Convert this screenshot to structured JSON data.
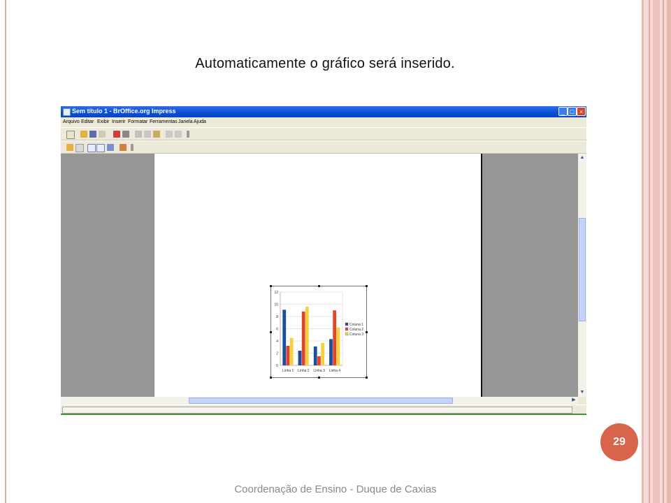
{
  "slide": {
    "title": "Automaticamente o gráfico será inserido.",
    "page_number": "29",
    "footer": "Coordenação de Ensino - Duque de Caxias"
  },
  "window": {
    "title": "Sem título 1 - BrOffice.org Impress",
    "controls": {
      "minimize": "_",
      "maximize": "□",
      "close": "×"
    }
  },
  "menu": [
    "Arquivo",
    "Editar",
    "Exibir",
    "Inserir",
    "Formatar",
    "Ferramentas",
    "Janela",
    "Ajuda"
  ],
  "colors": {
    "series1": "#1d4e9c",
    "series2": "#e0452a",
    "series3": "#f5d040",
    "accent": "#d9644c"
  },
  "chart_data": {
    "type": "bar",
    "categories": [
      "Linha 1",
      "Linha 2",
      "Linha 3",
      "Linha 4"
    ],
    "series": [
      {
        "name": "Coluna 1",
        "values": [
          9.1,
          2.4,
          3.1,
          4.3
        ]
      },
      {
        "name": "Coluna 2",
        "values": [
          3.2,
          8.8,
          1.5,
          9.0
        ]
      },
      {
        "name": "Coluna 3",
        "values": [
          4.5,
          9.6,
          3.7,
          6.2
        ]
      }
    ],
    "yticks": [
      "0",
      "2",
      "4",
      "6",
      "8",
      "10",
      "12"
    ],
    "ylim": [
      0,
      12
    ],
    "grid": true,
    "legend": "right"
  }
}
